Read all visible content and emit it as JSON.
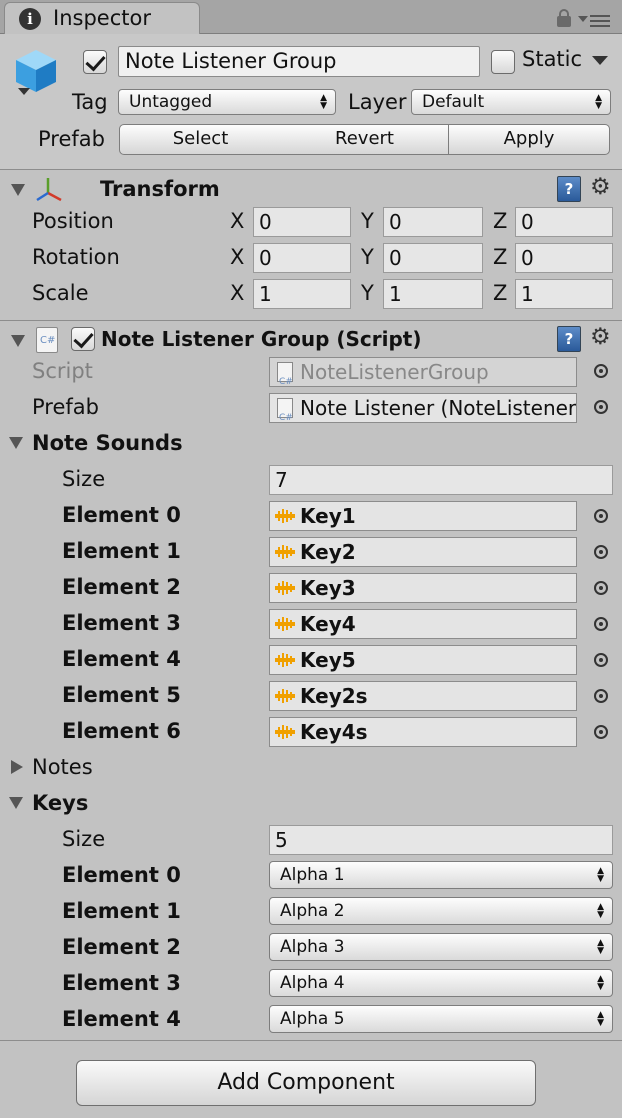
{
  "tab": {
    "title": "Inspector",
    "icon": "info-icon"
  },
  "gameobject": {
    "name": "Note Listener Group",
    "active": true,
    "static_label": "Static",
    "static_checked": false,
    "tag_label": "Tag",
    "tag_value": "Untagged",
    "layer_label": "Layer",
    "layer_value": "Default",
    "prefab_label": "Prefab",
    "prefab_buttons": {
      "select": "Select",
      "revert": "Revert",
      "apply": "Apply"
    }
  },
  "transform": {
    "title": "Transform",
    "axes": {
      "x": "X",
      "y": "Y",
      "z": "Z"
    },
    "rows": [
      {
        "label": "Position",
        "x": "0",
        "y": "0",
        "z": "0"
      },
      {
        "label": "Rotation",
        "x": "0",
        "y": "0",
        "z": "0"
      },
      {
        "label": "Scale",
        "x": "1",
        "y": "1",
        "z": "1"
      }
    ]
  },
  "script_component": {
    "title": "Note Listener Group (Script)",
    "enabled": true,
    "script_label": "Script",
    "script_value": "NoteListenerGroup",
    "prefab_label": "Prefab",
    "prefab_value": "Note Listener (NoteListener)",
    "note_sounds": {
      "label": "Note Sounds",
      "size_label": "Size",
      "size": "7",
      "elements": [
        {
          "label": "Element 0",
          "value": "Key1"
        },
        {
          "label": "Element 1",
          "value": "Key2"
        },
        {
          "label": "Element 2",
          "value": "Key3"
        },
        {
          "label": "Element 3",
          "value": "Key4"
        },
        {
          "label": "Element 4",
          "value": "Key5"
        },
        {
          "label": "Element 5",
          "value": "Key2s"
        },
        {
          "label": "Element 6",
          "value": "Key4s"
        }
      ]
    },
    "notes_label": "Notes",
    "keys": {
      "label": "Keys",
      "size_label": "Size",
      "size": "5",
      "elements": [
        {
          "label": "Element 0",
          "value": "Alpha 1"
        },
        {
          "label": "Element 1",
          "value": "Alpha 2"
        },
        {
          "label": "Element 2",
          "value": "Alpha 3"
        },
        {
          "label": "Element 3",
          "value": "Alpha 4"
        },
        {
          "label": "Element 4",
          "value": "Alpha 5"
        }
      ]
    }
  },
  "add_component": "Add Component",
  "colors": {
    "accent": "#2a5a9a",
    "audio_icon": "#f0a000",
    "background": "#c2c2c2"
  }
}
